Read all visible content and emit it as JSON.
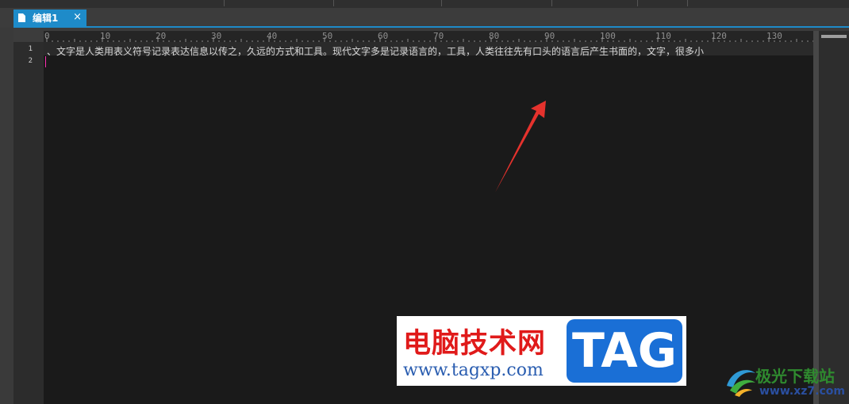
{
  "tab": {
    "title": "编辑1",
    "close": "×"
  },
  "ruler": {
    "labels": [
      "0",
      "10",
      "20",
      "30",
      "40",
      "50",
      "60",
      "70",
      "80",
      "90",
      "100",
      "110",
      "120",
      "130"
    ]
  },
  "gutter": {
    "line_numbers": [
      "1",
      "2"
    ]
  },
  "editor": {
    "line1": "、文字是人类用表义符号记录表达信息以传之，久远的方式和工具。现代文字多是记录语言的，工具，人类往往先有口头的语言后产生书面的，文字，很多小"
  },
  "watermark": {
    "site_cn": "电脑技术网",
    "site_url": "www.tagxp.com",
    "tag": "TAG",
    "brand_cn": "极光下载站",
    "brand_url": "www.xz7.com"
  },
  "colors": {
    "tab_accent": "#1e8bc9",
    "arrow": "#e5322d",
    "cursor": "#ff2fb0"
  }
}
